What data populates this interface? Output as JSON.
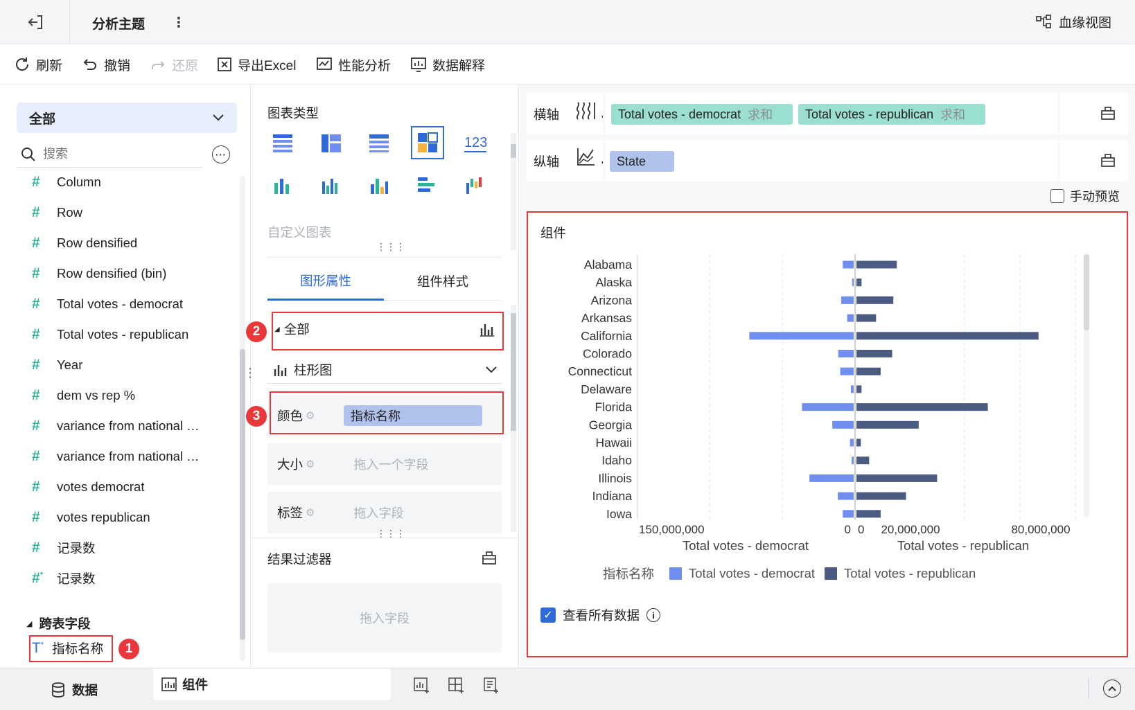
{
  "topbar": {
    "title": "分析主题",
    "lineage": "血缘视图"
  },
  "toolbar": {
    "refresh": "刷新",
    "undo": "撤销",
    "redo": "还原",
    "export": "导出Excel",
    "perf": "性能分析",
    "explain": "数据解释"
  },
  "left": {
    "dropdown": "全部",
    "search_placeholder": "搜索",
    "fields": [
      "Column",
      "Row",
      "Row densified",
      "Row densified (bin)",
      "Total votes - democrat",
      "Total votes - republican",
      "Year",
      "dem vs rep %",
      "variance from national …",
      "variance from national …",
      "votes democrat",
      "votes republican",
      "记录数",
      "记录数"
    ],
    "cross_section": "跨表字段",
    "cross_field": "指标名称"
  },
  "mid": {
    "chart_type_title": "图表类型",
    "custom_chart": "自定义图表",
    "tabs": [
      "图形属性",
      "组件样式"
    ],
    "all": "全部",
    "bar_type": "柱形图",
    "color_label": "颜色",
    "color_value": "指标名称",
    "size_label": "大小",
    "size_placeholder": "拖入一个字段",
    "tag_label": "标签",
    "tag_placeholder": "拖入字段",
    "filter_title": "结果过滤器",
    "filter_placeholder": "拖入字段"
  },
  "right": {
    "x_label": "横轴",
    "x_pills": [
      {
        "name": "Total votes - democrat",
        "agg": "求和"
      },
      {
        "name": "Total votes - republican",
        "agg": "求和"
      }
    ],
    "y_label": "纵轴",
    "y_pill": "State",
    "manual_preview": "手动预览",
    "component_title": "组件",
    "view_all": "查看所有数据"
  },
  "badges": [
    "1",
    "2",
    "3"
  ],
  "bottom": {
    "data_tab": "数据",
    "comp_tab": "组件"
  },
  "colors": {
    "dem": "#6f8ef0",
    "rep": "#4b5b82",
    "accent": "#2f6bd8",
    "red": "#e8383b",
    "teal": "#2bb49a"
  },
  "chart_data": {
    "type": "bar",
    "orientation": "horizontal",
    "categories": [
      "Alabama",
      "Alaska",
      "Arizona",
      "Arkansas",
      "California",
      "Colorado",
      "Connecticut",
      "Delaware",
      "Florida",
      "Georgia",
      "Hawaii",
      "Idaho",
      "Illinois",
      "Indiana",
      "Iowa"
    ],
    "series": [
      {
        "name": "Total votes - democrat",
        "axis": "left",
        "values": [
          11000000,
          1500000,
          12500000,
          6500000,
          105000000,
          15500000,
          13500000,
          2800000,
          52000000,
          21500000,
          3700000,
          2000000,
          44500000,
          16000000,
          11000000
        ]
      },
      {
        "name": "Total votes - republican",
        "axis": "right",
        "values": [
          17500000,
          2200000,
          16000000,
          8500000,
          79000000,
          15500000,
          10500000,
          2200000,
          57000000,
          27000000,
          1900000,
          5500000,
          35000000,
          21500000,
          10500000
        ]
      }
    ],
    "left_axis": {
      "label": "Total votes - democrat",
      "ticks": [
        "150,000,000",
        "0"
      ]
    },
    "right_axis": {
      "label": "Total votes - republican",
      "ticks": [
        "0",
        "20,000,000",
        "80,000,000"
      ]
    },
    "legend_title": "指标名称",
    "legend": [
      "Total votes - democrat",
      "Total votes - republican"
    ]
  }
}
